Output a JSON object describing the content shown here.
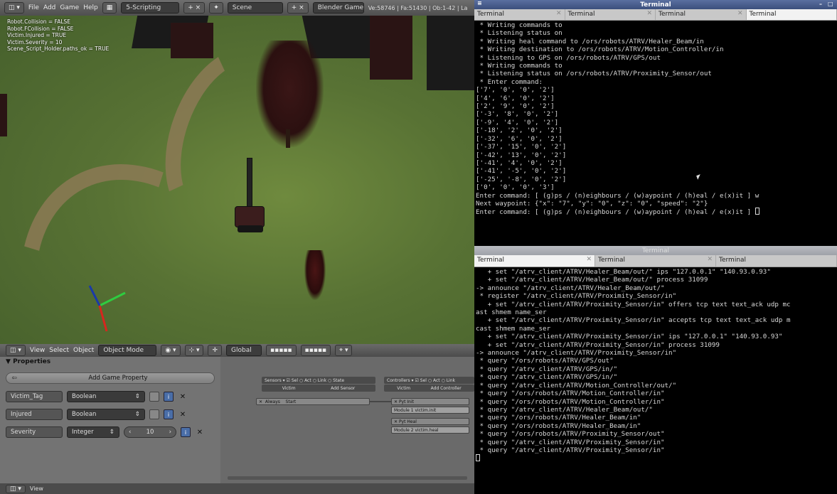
{
  "blender": {
    "topbar": {
      "menus": [
        "File",
        "Add",
        "Game",
        "Help"
      ],
      "screen_layout": "5-Scripting",
      "scene": "Scene",
      "engine": "Blender Game",
      "stats": "Ve:58746 | Fa:51430 | Ob:1-42 | La"
    },
    "viewport": {
      "debug_lines": [
        "Robot.Collision = FALSE",
        "Robot.FCollision = FALSE",
        "Victim.Injured = TRUE",
        "Victim.Severity = 10",
        "Scene_Script_Holder.paths_ok = TRUE"
      ]
    },
    "view_header": {
      "menus": [
        "View",
        "Select",
        "Object"
      ],
      "mode": "Object Mode",
      "orientation": "Global"
    },
    "properties": {
      "title": "Properties",
      "add_label": "Add Game Property",
      "rows": [
        {
          "name": "Victim_Tag",
          "type": "Boolean"
        },
        {
          "name": "Injured",
          "type": "Boolean"
        },
        {
          "name": "Severity",
          "type": "Integer",
          "value": "10"
        }
      ]
    },
    "logic": {
      "sensors_hdr": "Sensors",
      "controllers_hdr": "Controllers",
      "sensor_sel": "Sel",
      "sensor_act": "Act",
      "sensor_link": "Link",
      "sensor_state": "State",
      "victim": "Victim",
      "add_sensor": "Add Sensor",
      "add_controller": "Add Controller",
      "always": "Always",
      "start": "Start",
      "py": "Pyt",
      "module1": "Module 1",
      "module2": "Module 2",
      "mod1_val": "victim.init",
      "mod2_val": "victim.heal",
      "init": "Init",
      "heal": "Heal"
    },
    "bottom": {
      "label": "View"
    }
  },
  "terminal_top": {
    "title": "Terminal",
    "tabs": [
      "Terminal",
      "Terminal",
      "Terminal",
      "Terminal"
    ],
    "active_tab": 3,
    "lines": [
      " * Writing commands to",
      " * Listening status on",
      " * Writing heal command to /ors/robots/ATRV/Healer_Beam/in",
      " * Writing destination to /ors/robots/ATRV/Motion_Controller/in",
      " * Listening to GPS on /ors/robots/ATRV/GPS/out",
      " * Writing commands to",
      " * Listening status on /ors/robots/ATRV/Proximity_Sensor/out",
      " * Enter command:",
      "['7', '0', '0', '2']",
      "['4', '6', '0', '2']",
      "['2', '9', '0', '2']",
      "['-3', '8', '0', '2']",
      "['-9', '4', '0', '2']",
      "['-18', '2', '0', '2']",
      "['-32', '6', '0', '2']",
      "['-37', '15', '0', '2']",
      "['-42', '13', '0', '2']",
      "['-41', '4', '0', '2']",
      "['-41', '-5', '0', '2']",
      "['-25', '-8', '0', '2']",
      "['0', '0', '0', '3']",
      "Enter command: [ (g)ps / (n)eighbours / (w)aypoint / (h)eal / e(x)it ] w",
      "Next waypoint: {\"x\": \"7\", \"y\": \"0\", \"z\": \"0\", \"speed\": \"2\"}",
      "Enter command: [ (g)ps / (n)eighbours / (w)aypoint / (h)eal / e(x)it ] "
    ]
  },
  "terminal_bottom": {
    "title": "Terminal",
    "tabs": [
      "Terminal",
      "Terminal",
      "Terminal"
    ],
    "active_tab": 0,
    "lines": [
      "   + set \"/atrv_client/ATRV/Healer_Beam/out/\" ips \"127.0.0.1\" \"140.93.0.93\"",
      "   + set \"/atrv_client/ATRV/Healer_Beam/out/\" process 31099",
      "-> announce \"/atrv_client/ATRV/Healer_Beam/out/\"",
      " * register \"/atrv_client/ATRV/Proximity_Sensor/in\"",
      "   + set \"/atrv_client/ATRV/Proximity_Sensor/in\" offers tcp text text_ack udp mc",
      "ast shmem name_ser",
      "   + set \"/atrv_client/ATRV/Proximity_Sensor/in\" accepts tcp text text_ack udp m",
      "cast shmem name_ser",
      "   + set \"/atrv_client/ATRV/Proximity_Sensor/in\" ips \"127.0.0.1\" \"140.93.0.93\"",
      "   + set \"/atrv_client/ATRV/Proximity_Sensor/in\" process 31099",
      "-> announce \"/atrv_client/ATRV/Proximity_Sensor/in\"",
      " * query \"/ors/robots/ATRV/GPS/out\"",
      " * query \"/atrv_client/ATRV/GPS/in/\"",
      " * query \"/atrv_client/ATRV/GPS/in/\"",
      " * query \"/atrv_client/ATRV/Motion_Controller/out/\"",
      " * query \"/ors/robots/ATRV/Motion_Controller/in\"",
      " * query \"/ors/robots/ATRV/Motion_Controller/in\"",
      " * query \"/atrv_client/ATRV/Healer_Beam/out/\"",
      " * query \"/ors/robots/ATRV/Healer_Beam/in\"",
      " * query \"/ors/robots/ATRV/Healer_Beam/in\"",
      " * query \"/ors/robots/ATRV/Proximity_Sensor/out\"",
      " * query \"/atrv_client/ATRV/Proximity_Sensor/in\"",
      " * query \"/atrv_client/ATRV/Proximity_Sensor/in\""
    ]
  }
}
